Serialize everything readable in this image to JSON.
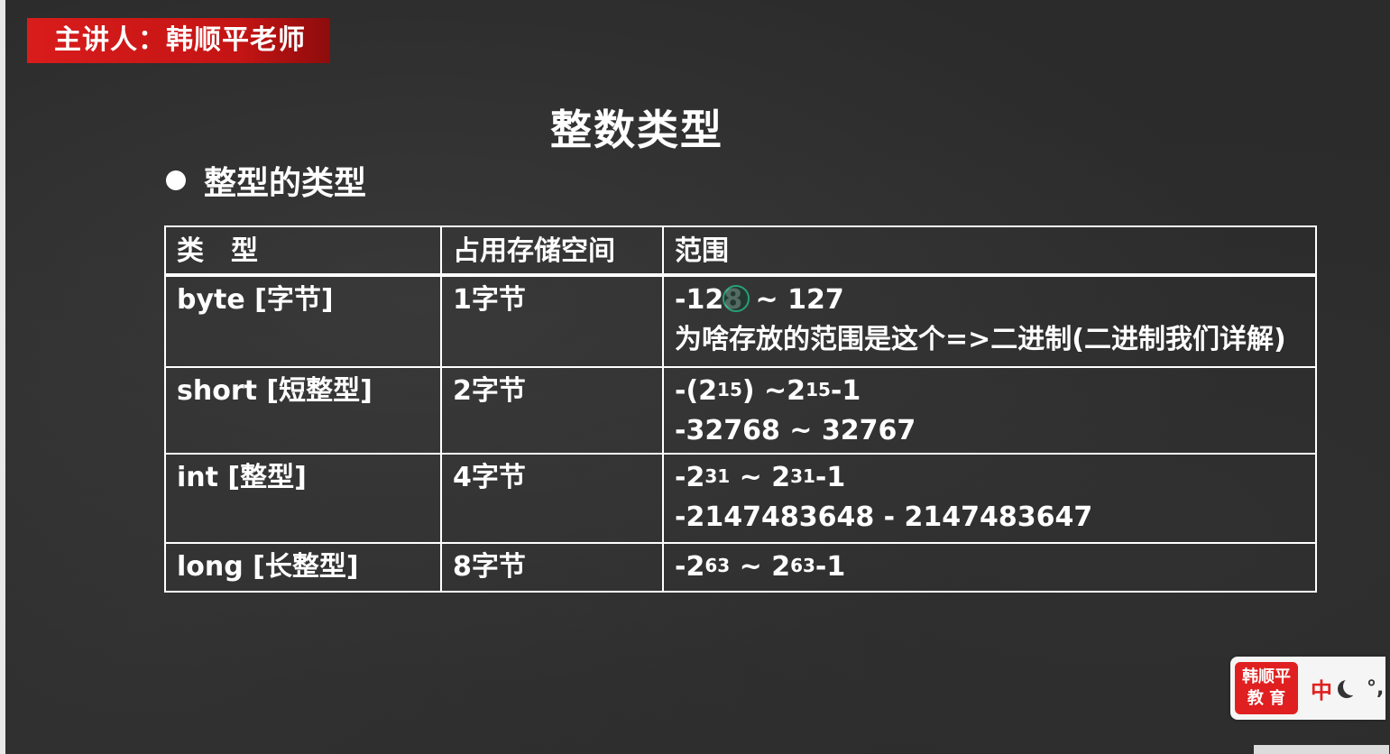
{
  "banner": {
    "speaker": "主讲人：韩顺平老师"
  },
  "slide": {
    "title": "整数类型",
    "bullet": "整型的类型"
  },
  "table": {
    "headers": [
      "类　型",
      "占用存储空间",
      "范围"
    ],
    "rows": [
      {
        "type": "byte [字节]",
        "size": "1字节",
        "range_line1_pre": "-12",
        "range_line1_mid": "8",
        "range_line1_post": " ~ 127",
        "range_line2": "为啥存放的范围是这个=>二进制(二进制我们详解)"
      },
      {
        "type": "short [短整型]",
        "size": "2字节",
        "range_line1": {
          "a": "-(2",
          "exp1": "15",
          "b": ") ~2",
          "exp2": "15",
          "c": "-1"
        },
        "range_line2": "-32768 ~ 32767"
      },
      {
        "type": "int [整型]",
        "size": "4字节",
        "range_line1": {
          "a": "-2",
          "exp1": "31",
          "b": " ~ 2",
          "exp2": "31",
          "c": "-1"
        },
        "range_line2": "-2147483648 - 2147483647"
      },
      {
        "type": "long [长整型]",
        "size": "8字节",
        "range_line1": {
          "a": "-2",
          "exp1": "63",
          "b": " ~ 2",
          "exp2": "63",
          "c": "-1"
        }
      }
    ]
  },
  "brand": {
    "logo_line1": "韩顺平",
    "logo_line2": "教 育",
    "lang": "中",
    "punct": "°,",
    "icons": [
      "moon-icon"
    ]
  },
  "colors": {
    "banner_red": "#d91c1c",
    "board_bg": "#2b2b2b",
    "text": "#ffffff",
    "cursor_green": "#24c48a"
  }
}
